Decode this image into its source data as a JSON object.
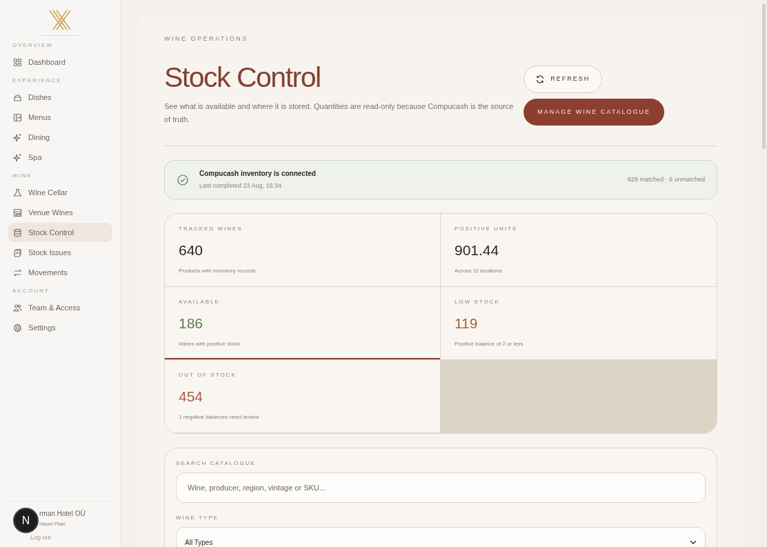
{
  "sidebar": {
    "sections": [
      {
        "heading": "OVERVIEW",
        "items": [
          {
            "label": "Dashboard",
            "selected": false
          }
        ]
      },
      {
        "heading": "EXPERIENCE",
        "items": [
          {
            "label": "Dishes",
            "selected": false
          },
          {
            "label": "Menus",
            "selected": false
          },
          {
            "label": "Dining",
            "selected": false
          },
          {
            "label": "Spa",
            "selected": false
          }
        ]
      },
      {
        "heading": "WINE",
        "items": [
          {
            "label": "Wine Cellar",
            "selected": false
          },
          {
            "label": "Venue Wines",
            "selected": false
          },
          {
            "label": "Stock Control",
            "selected": true
          },
          {
            "label": "Stock Issues",
            "selected": false
          },
          {
            "label": "Movements",
            "selected": false
          }
        ]
      },
      {
        "heading": "ACCOUNT",
        "items": [
          {
            "label": "Team & Access",
            "selected": false
          },
          {
            "label": "Settings",
            "selected": false
          }
        ]
      }
    ],
    "account": {
      "name": "rman Hotel OÜ",
      "plan": "mium Plan",
      "logout": "Log out"
    },
    "dev_badge": "N"
  },
  "header": {
    "eyebrow": "WINE OPERATIONS",
    "title": "Stock Control",
    "description": "See what is available and where it is stored. Quantities are read-only because Compucash is the source of truth.",
    "buttons": [
      {
        "label": "REFRESH",
        "kind": "outline"
      },
      {
        "label": "MANAGE WINE CATALOGUE",
        "kind": "primary"
      }
    ]
  },
  "status": {
    "title": "Compucash inventory is connected",
    "subtitle": "Last completed 23 Aug, 15:34",
    "summary": "829 matched · 6 unmatched"
  },
  "stats": [
    {
      "label": "TRACKED WINES",
      "value": "640",
      "note": "Products with inventory records",
      "color": "#2b2522",
      "selected": false
    },
    {
      "label": "POSITIVE UNITS",
      "value": "901.44",
      "note": "Across 11 locations",
      "color": "#2b2522",
      "selected": false
    },
    {
      "label": "AVAILABLE",
      "value": "186",
      "note": "Wines with positive stock",
      "color": "#5f7a52",
      "selected": true
    },
    {
      "label": "LOW STOCK",
      "value": "119",
      "note": "Positive balance of 2 or less",
      "color": "#a8623d",
      "selected": false
    },
    {
      "label": "OUT OF STOCK",
      "value": "454",
      "note": "1 negative balances need review",
      "color": "#a8623d",
      "selected": false
    }
  ],
  "filters": {
    "search_label": "SEARCH CATALOGUE",
    "search": {
      "placeholder": "Wine, producer, region, vintage or SKU..."
    },
    "type_label": "WINE TYPE",
    "type": {
      "value": "All Types"
    }
  }
}
